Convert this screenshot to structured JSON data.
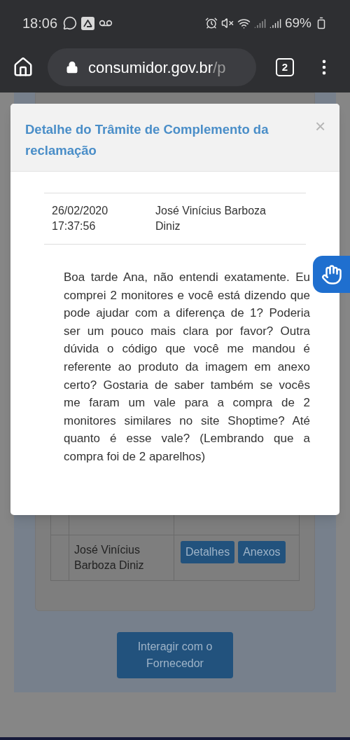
{
  "status_bar": {
    "time": "18:06",
    "battery": "69%"
  },
  "browser": {
    "url_host": "consumidor.gov.br",
    "url_rest": "/p",
    "tab_count": "2"
  },
  "table": {
    "rows": [
      {
        "name": "",
        "actions": []
      },
      {
        "name": "José Vinícius Barboza Diniz",
        "actions": [
          "Detalhes",
          "Anexos"
        ]
      }
    ]
  },
  "interact_button": "Interagir com o Fornecedor",
  "modal": {
    "title": "Detalhe do Trâmite de Complemento da reclamação",
    "close": "×",
    "entry": {
      "date": "26/02/2020 17:37:56",
      "author": "José Vinícius Barboza Diniz"
    },
    "message": "Boa tarde Ana, não entendi exatamente. Eu comprei 2 monitores e você está dizendo que pode ajudar com a diferença de 1? Poderia ser um pouco mais clara por favor? Outra dúvida o código que você me mandou é referente ao produto da imagem em anexo certo? Gostaria de saber também se vocês me faram um vale para a compra de 2 monitores similares no site Shoptime? Até quanto é esse vale? (Lembrando que a compra foi de 2 aparelhos)"
  }
}
